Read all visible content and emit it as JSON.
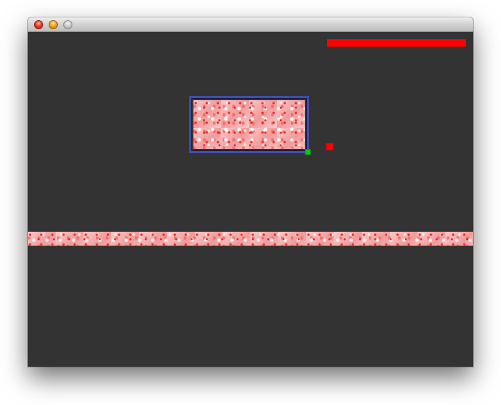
{
  "window": {
    "title": "",
    "buttons": [
      "close",
      "minimize",
      "zoom"
    ]
  },
  "scene": {
    "background_color": "#333333",
    "health": {
      "fraction": 1.0,
      "color": "#ff0000"
    },
    "entities": {
      "player_color": "#ff0000",
      "marker_color": "#17c21a",
      "block_border_color": "#3f4fa8",
      "flesh_texture_color": "#f7b7b7"
    }
  }
}
